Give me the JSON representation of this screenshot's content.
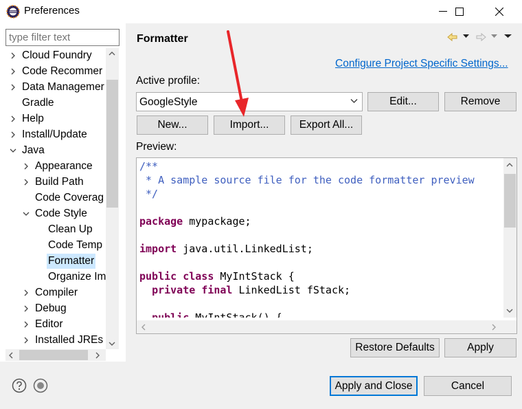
{
  "window": {
    "title": "Preferences"
  },
  "filter": {
    "placeholder": "type filter text"
  },
  "tree": {
    "items": [
      {
        "label": "Cloud Foundry",
        "level": 0,
        "expander": "collapsed"
      },
      {
        "label": "Code Recommer",
        "level": 0,
        "expander": "collapsed"
      },
      {
        "label": "Data Managemer",
        "level": 0,
        "expander": "collapsed"
      },
      {
        "label": "Gradle",
        "level": 0,
        "expander": "none"
      },
      {
        "label": "Help",
        "level": 0,
        "expander": "collapsed"
      },
      {
        "label": "Install/Update",
        "level": 0,
        "expander": "collapsed"
      },
      {
        "label": "Java",
        "level": 0,
        "expander": "expanded"
      },
      {
        "label": "Appearance",
        "level": 1,
        "expander": "collapsed"
      },
      {
        "label": "Build Path",
        "level": 1,
        "expander": "collapsed"
      },
      {
        "label": "Code Coverag",
        "level": 1,
        "expander": "none"
      },
      {
        "label": "Code Style",
        "level": 1,
        "expander": "expanded"
      },
      {
        "label": "Clean Up",
        "level": 2,
        "expander": "none"
      },
      {
        "label": "Code Temp",
        "level": 2,
        "expander": "none"
      },
      {
        "label": "Formatter",
        "level": 2,
        "expander": "none",
        "selected": true
      },
      {
        "label": "Organize Im",
        "level": 2,
        "expander": "none"
      },
      {
        "label": "Compiler",
        "level": 1,
        "expander": "collapsed"
      },
      {
        "label": "Debug",
        "level": 1,
        "expander": "collapsed"
      },
      {
        "label": "Editor",
        "level": 1,
        "expander": "collapsed"
      },
      {
        "label": "Installed JREs",
        "level": 1,
        "expander": "collapsed"
      }
    ]
  },
  "page": {
    "title": "Formatter",
    "configure_link": "Configure Project Specific Settings...",
    "active_profile_label": "Active profile:",
    "profile_value": "GoogleStyle",
    "edit_label": "Edit...",
    "remove_label": "Remove",
    "new_label": "New...",
    "import_label": "Import...",
    "export_label": "Export All...",
    "preview_label": "Preview:",
    "restore_label": "Restore Defaults",
    "apply_label": "Apply"
  },
  "preview_code": [
    [
      {
        "t": "/**",
        "c": "comment"
      }
    ],
    [
      {
        "t": " * A sample source file for the code formatter preview",
        "c": "comment"
      }
    ],
    [
      {
        "t": " */",
        "c": "comment"
      }
    ],
    [],
    [
      {
        "t": "package",
        "c": "kw"
      },
      {
        "t": " mypackage;",
        "c": ""
      }
    ],
    [],
    [
      {
        "t": "import",
        "c": "kw"
      },
      {
        "t": " java.util.LinkedList;",
        "c": ""
      }
    ],
    [],
    [
      {
        "t": "public",
        "c": "kw"
      },
      {
        "t": " ",
        "c": ""
      },
      {
        "t": "class",
        "c": "kw"
      },
      {
        "t": " MyIntStack {",
        "c": ""
      }
    ],
    [
      {
        "t": "  ",
        "c": ""
      },
      {
        "t": "private",
        "c": "kw"
      },
      {
        "t": " ",
        "c": ""
      },
      {
        "t": "final",
        "c": "kw"
      },
      {
        "t": " LinkedList fStack;",
        "c": ""
      }
    ],
    [],
    [
      {
        "t": "  ",
        "c": ""
      },
      {
        "t": "public",
        "c": "kw"
      },
      {
        "t": " MyIntStack() {",
        "c": ""
      }
    ]
  ],
  "footer": {
    "apply_close_label": "Apply and Close",
    "cancel_label": "Cancel"
  },
  "colors": {
    "accent": "#0078d7",
    "link": "#0066cc",
    "annotation_arrow": "#e8262a"
  }
}
